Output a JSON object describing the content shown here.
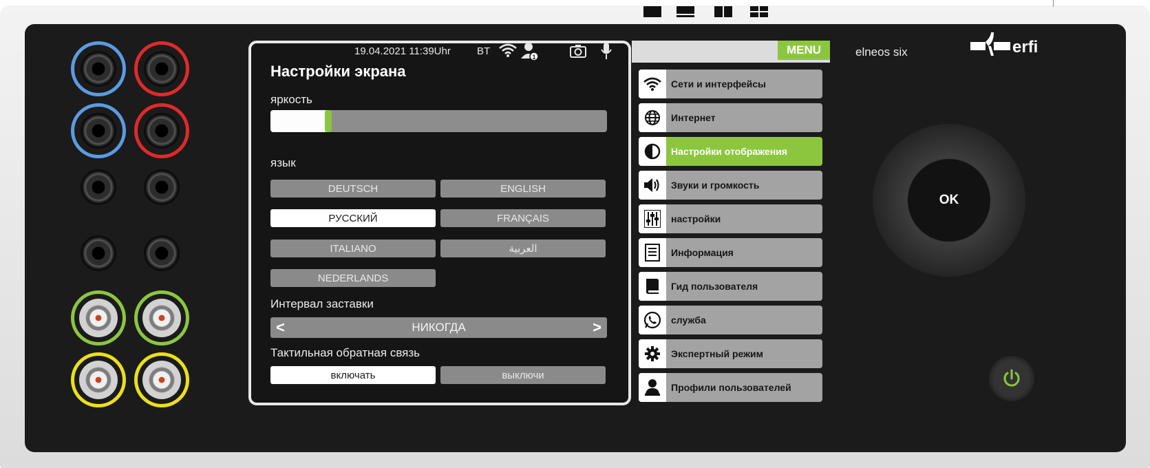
{
  "status_bar": {
    "datetime": "19.04.2021 11:39Uhr",
    "bt": "BT"
  },
  "screen": {
    "title": "Настройки экрана",
    "brightness": {
      "label": "яркость",
      "level": 0.17
    },
    "language": {
      "label": "язык",
      "options": [
        "DEUTSCH",
        "ENGLISH",
        "РУССКИЙ",
        "FRANÇAIS",
        "ITALIANO",
        "العربية",
        "NEDERLANDS"
      ],
      "selected": "РУССКИЙ"
    },
    "screensaver": {
      "label": "Интервал заставки",
      "value": "НИКОГДА",
      "prev": "<",
      "next": ">"
    },
    "haptic": {
      "label": "Тактильная обратная связь",
      "on": "включать",
      "off": "выключи",
      "selected": "включать"
    }
  },
  "menu_bar": {
    "menu_label": "MENU"
  },
  "menu": {
    "items": [
      {
        "label": "Сети и интерфейсы",
        "icon": "wifi-icon"
      },
      {
        "label": "Интернет",
        "icon": "globe-icon"
      },
      {
        "label": "Настройки отображения",
        "icon": "contrast-icon",
        "active": true
      },
      {
        "label": "Звуки и громкость",
        "icon": "speaker-icon"
      },
      {
        "label": "настройки",
        "icon": "sliders-icon"
      },
      {
        "label": "Информация",
        "icon": "document-icon"
      },
      {
        "label": "Гид пользователя",
        "icon": "book-icon"
      },
      {
        "label": "служба",
        "icon": "phone-icon"
      },
      {
        "label": "Экспертный режим",
        "icon": "gear-icon"
      },
      {
        "label": "Профили пользователей",
        "icon": "user-icon"
      }
    ]
  },
  "device": {
    "model": "elneos six",
    "brand": "erfi",
    "ok_label": "OK"
  },
  "colors": {
    "accent": "#8cc63f",
    "jack_blue": "#5b9be0",
    "jack_red": "#e02a2a",
    "jack_green": "#8cc63f",
    "jack_yellow": "#ecdf1c"
  }
}
